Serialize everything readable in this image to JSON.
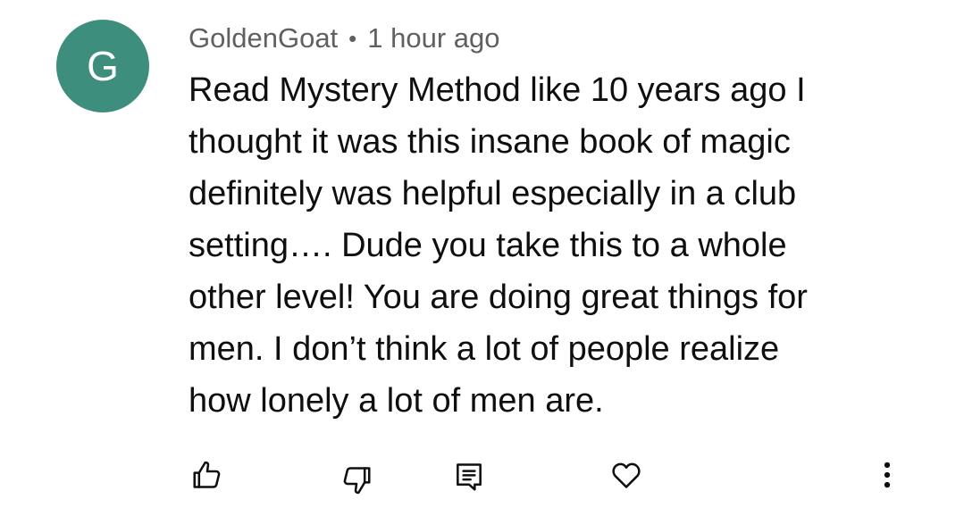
{
  "comment": {
    "avatar_letter": "G",
    "avatar_color": "#3e8e7e",
    "author": "GoldenGoat",
    "separator": "•",
    "timestamp": "1 hour ago",
    "text_lines": [
      "Read Mystery Method like 10 years ago I",
      "thought it was this insane book of magic",
      "definitely was helpful especially in a club",
      "setting…. Dude you take this to a whole",
      "other level! You are doing great things for",
      "men. I don’t think a lot of people realize",
      "how lonely a lot of men are."
    ]
  },
  "actions": {
    "like_icon": "thumbs-up-icon",
    "dislike_icon": "thumbs-down-icon",
    "reply_icon": "reply-icon",
    "heart_icon": "heart-icon",
    "more_icon": "more-vertical-icon"
  }
}
